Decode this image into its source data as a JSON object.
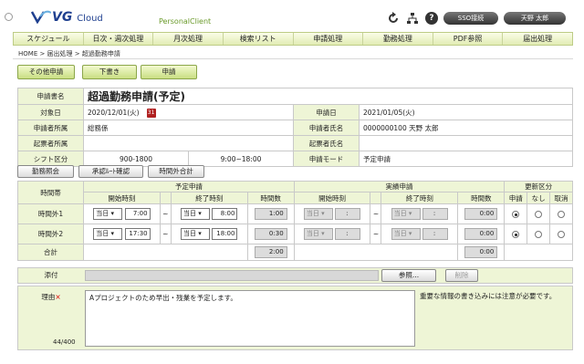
{
  "header": {
    "brand": "VG",
    "brand_sub": "Cloud",
    "personal": "PersonalClient",
    "pill_1": "SSO接続",
    "pill_2": "天野 太郎"
  },
  "nav": [
    "スケジュール",
    "日次・週次処理",
    "月次処理",
    "検索リスト",
    "申請処理",
    "勤務処理",
    "PDF参照",
    "届出処理"
  ],
  "breadcrumb": "HOME > 届出処理 > 超過勤務申請",
  "buttons": {
    "other": "その他申請",
    "draft": "下書き",
    "apply": "申請"
  },
  "info": {
    "type_label": "申請書名",
    "type_value": "超過勤務申請(予定)",
    "target_label": "対象日",
    "target_value": "2020/12/01(火)",
    "cal": "31",
    "apply_date_label": "申請日",
    "apply_date_value": "2021/01/05(火)",
    "dept_label": "申請者所属",
    "dept_value": "総務係",
    "name_label": "申請者氏名",
    "name_value": "0000000100 天野 太郎",
    "draft_dept_label": "起票者所属",
    "draft_name_label": "起票者氏名",
    "shift_label": "シフト区分",
    "shift_a": "900-1800",
    "shift_b": "9:00~18:00",
    "mode_label": "申請モード",
    "mode_value": "予定申請"
  },
  "tabs": {
    "a": "勤務照会",
    "b": "承認ﾙｰﾄ確認",
    "c": "時間外合計"
  },
  "grid": {
    "band": "時間帯",
    "plan": "予定申請",
    "actual": "実績申請",
    "update": "更新区分",
    "start": "開始時刻",
    "end": "終了時刻",
    "hours": "時間数",
    "opt_apply": "申請",
    "opt_none": "なし",
    "opt_cancel": "取消",
    "row1_label": "時間外1",
    "row2_label": "時間外2",
    "day": "当日",
    "row1_start": "7:00",
    "row1_end": "8:00",
    "row1_hours": "1:00",
    "row2_start": "17:30",
    "row2_end": "18:00",
    "row2_hours": "0:30",
    "tilde": "~",
    "colon": ":",
    "zero": "0:00",
    "total_label": "合計",
    "total_plan": "2:00",
    "total_actual": "0:00"
  },
  "attach": {
    "label": "添付",
    "browse": "参照...",
    "delete": "削除"
  },
  "reason": {
    "label": "理由",
    "req": "×",
    "text": "Aプロジェクトのため早出・残業を予定します。",
    "count": "44/400",
    "note": "重要な情報の書き込みには注意が必要です。"
  }
}
